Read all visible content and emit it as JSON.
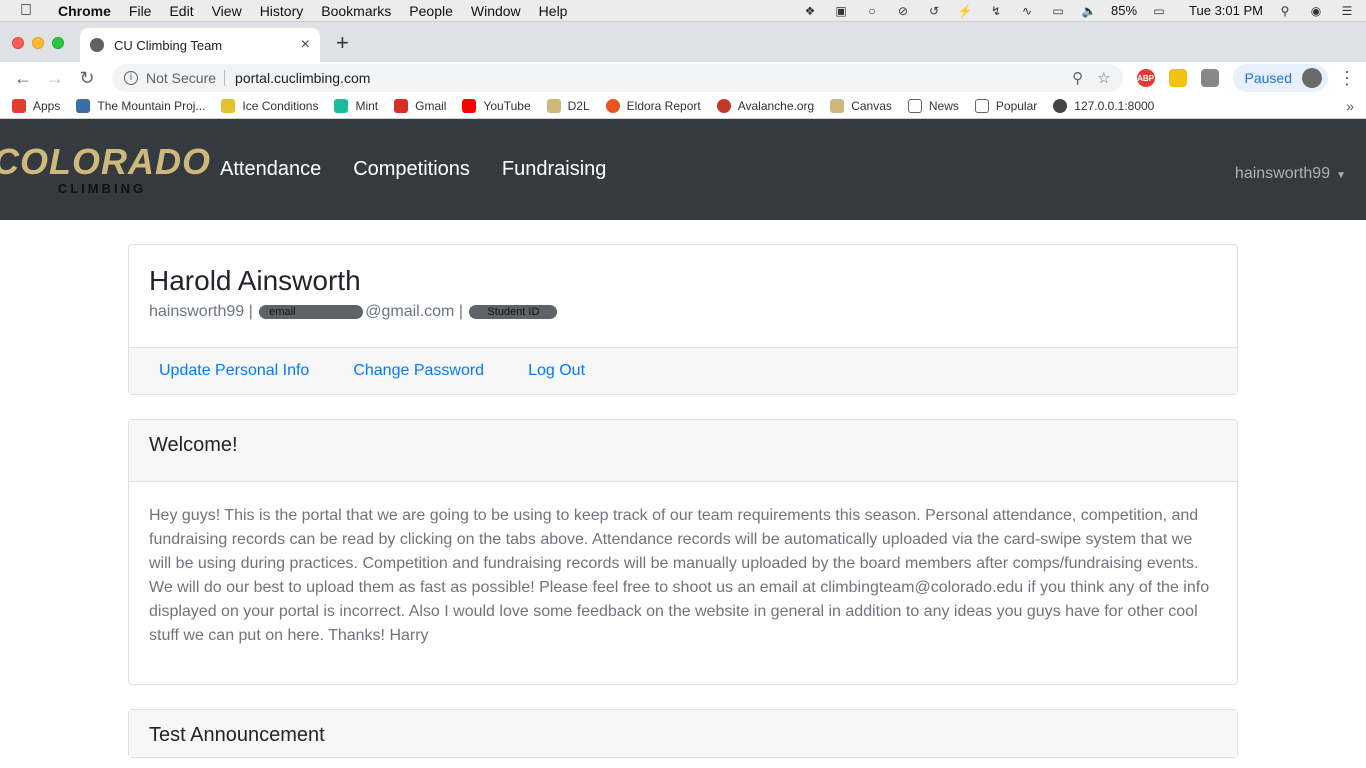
{
  "menubar": {
    "app": "Chrome",
    "items": [
      "File",
      "Edit",
      "View",
      "History",
      "Bookmarks",
      "People",
      "Window",
      "Help"
    ],
    "battery": "85%",
    "clock": "Tue 3:01 PM"
  },
  "browser": {
    "tab_title": "CU Climbing Team",
    "security_label": "Not Secure",
    "url": "portal.cuclimbing.com",
    "profile_status": "Paused"
  },
  "bookmarks": [
    {
      "label": "Apps",
      "color": "#e33b2e"
    },
    {
      "label": "The Mountain Proj...",
      "color": "#3a6ea5"
    },
    {
      "label": "Ice Conditions",
      "color": "#e3c22c"
    },
    {
      "label": "Mint",
      "color": "#1abc9c"
    },
    {
      "label": "Gmail",
      "color": "#d93025"
    },
    {
      "label": "YouTube",
      "color": "#ff0000"
    },
    {
      "label": "D2L",
      "color": "#cfb87c"
    },
    {
      "label": "Eldora Report",
      "color": "#e8541e"
    },
    {
      "label": "Avalanche.org",
      "color": "#c0392b"
    },
    {
      "label": "Canvas",
      "color": "#cfb87c"
    },
    {
      "label": "News",
      "color": "#888888"
    },
    {
      "label": "Popular",
      "color": "#888888"
    },
    {
      "label": "127.0.0.1:8000",
      "color": "#444444"
    }
  ],
  "site": {
    "logo_main": "COLORADO",
    "logo_sub": "CLIMBING",
    "nav": [
      "Attendance",
      "Competitions",
      "Fundraising"
    ],
    "username_menu": "hainsworth99"
  },
  "profile": {
    "name": "Harold Ainsworth",
    "username": "hainsworth99",
    "email_redaction_label": "email",
    "email_domain": "@gmail.com",
    "student_id_redaction_label": "Student ID",
    "links": [
      "Update Personal Info",
      "Change Password",
      "Log Out"
    ]
  },
  "announcements": [
    {
      "title": "Welcome!",
      "body": "Hey guys! This is the portal that we are going to be using to keep track of our team requirements this season. Personal attendance, competition, and fundraising records can be read by clicking on the tabs above. Attendance records will be automatically uploaded via the card-swipe system that we will be using during practices. Competition and fundraising records will be manually uploaded by the board members after comps/fundraising events. We will do our best to upload them as fast as possible! Please feel free to shoot us an email at climbingteam@colorado.edu if you think any of the info displayed on your portal is incorrect. Also I would love some feedback on the website in general in addition to any ideas you guys have for other cool stuff we can put on here. Thanks! Harry"
    },
    {
      "title": "Test Announcement",
      "body": ""
    }
  ]
}
